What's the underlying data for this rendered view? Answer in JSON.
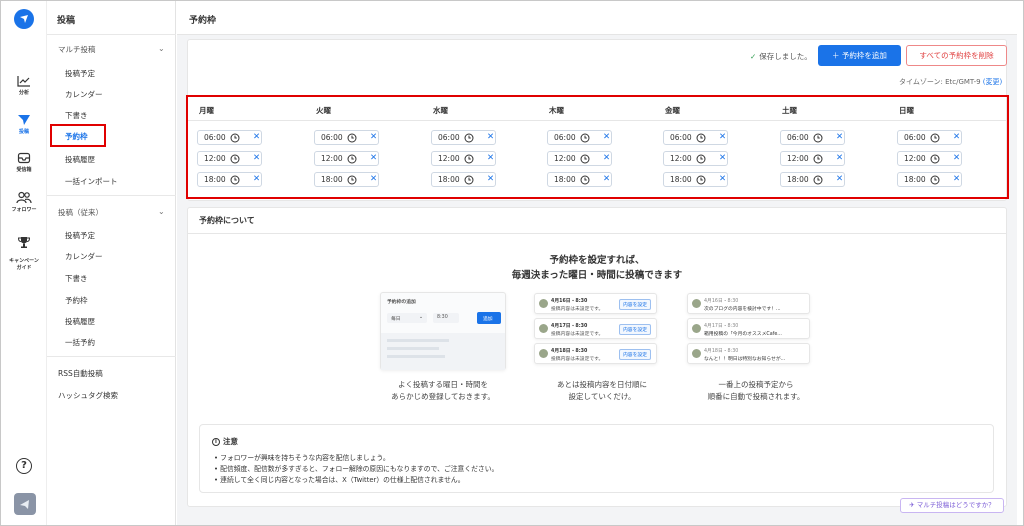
{
  "rail": {
    "items": [
      {
        "label": "分析",
        "icon": "chart-icon"
      },
      {
        "label": "投稿",
        "icon": "send-icon"
      },
      {
        "label": "受信箱",
        "icon": "inbox-icon"
      },
      {
        "label": "フォロワー",
        "icon": "followers-icon"
      },
      {
        "label": "キャンペーン\nガイド",
        "icon": "trophy-icon"
      }
    ]
  },
  "sidebar": {
    "title": "投稿",
    "group1": {
      "label": "マルチ投稿",
      "items": [
        "投稿予定",
        "カレンダー",
        "下書き",
        "予約枠",
        "投稿履歴",
        "一括インポート"
      ]
    },
    "group2": {
      "label": "投稿（従来）",
      "items": [
        "投稿予定",
        "カレンダー",
        "下書き",
        "予約枠",
        "投稿履歴",
        "一括予約"
      ]
    },
    "extra": [
      "RSS自動投稿",
      "ハッシュタグ検索"
    ]
  },
  "page": {
    "title": "予約枠",
    "saved_text": "保存しました。",
    "add_button": "＋  予約枠を追加",
    "delete_button": "すべての予約枠を削除",
    "timezone_label": "タイムゾーン: Etc/GMT-9",
    "timezone_change": "(変更)"
  },
  "schedule": {
    "days": [
      "月曜",
      "火曜",
      "水曜",
      "木曜",
      "金曜",
      "土曜",
      "日曜"
    ],
    "times": [
      "06:00",
      "12:00",
      "18:00"
    ]
  },
  "about": {
    "title": "予約枠について",
    "hero_line1": "予約枠を設定すれば、",
    "hero_line2": "毎週決まった曜日・時間に投稿できます",
    "ill1": {
      "title": "予約枠の追加",
      "select": "毎日",
      "time": "8:30",
      "button": "追加"
    },
    "ill2": {
      "rows": [
        {
          "date": "4月16日・8:30",
          "note": "投稿内容は未設定です。",
          "btn": "内容を設定"
        },
        {
          "date": "4月17日・8:30",
          "note": "投稿内容は未設定です。",
          "btn": "内容を設定"
        },
        {
          "date": "4月18日・8:30",
          "note": "投稿内容は未設定です。",
          "btn": "内容を設定"
        }
      ]
    },
    "ill3": {
      "rows": [
        {
          "date": "4月16日・8:30",
          "text": "次のブログの内容を検討中です！..."
        },
        {
          "date": "4月17日・8:30",
          "text": "箱用投稿の「今月のオススメCafe..."
        },
        {
          "date": "4月18日・8:30",
          "text": "なんと！！明日は特別なお知らせが..."
        }
      ]
    },
    "captions": [
      [
        "よく投稿する曜日・時間を",
        "あらかじめ登録しておきます。"
      ],
      [
        "あとは投稿内容を日付順に",
        "設定していくだけ。"
      ],
      [
        "一番上の投稿予定から",
        "順番に自動で投稿されます。"
      ]
    ]
  },
  "notice": {
    "title": "注意",
    "items": [
      "フォロワーが興味を持ちそうな内容を配信しましょう。",
      "配信頻度、配信数が多すぎると、フォロー解除の原因にもなりますので、ご注意ください。",
      "連続して全く同じ内容となった場合は、X（Twitter）の仕様上配信されません。"
    ]
  },
  "help_button": "マルチ投稿はどうですか？",
  "colors": {
    "accent": "#1a73e8",
    "highlight": "#e00000"
  }
}
